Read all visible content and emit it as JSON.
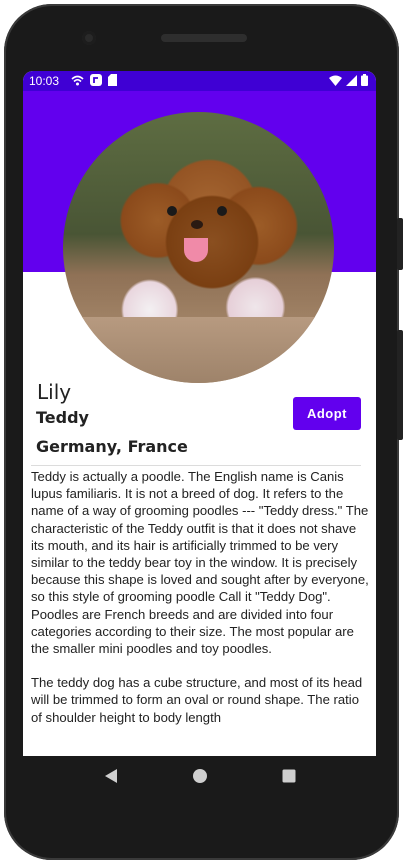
{
  "status": {
    "time": "10:03"
  },
  "pet": {
    "name": "Lily",
    "breed": "Teddy",
    "origin": "Germany, France"
  },
  "actions": {
    "adopt_label": "Adopt"
  },
  "description": {
    "paragraph1": "Teddy is actually a poodle. The English name is Canis lupus familiaris. It is not a breed of dog. It refers to the name of a way of grooming poodles --- \"Teddy dress.\" The characteristic of the Teddy outfit is that it does not shave its mouth, and its hair is artificially trimmed to be very similar to the teddy bear toy in the window. It is precisely because this shape is loved and sought after by everyone, so this style of grooming poodle Call it \"Teddy Dog\". Poodles are French breeds and are divided into four categories according to their size. The most popular are the smaller mini poodles and toy poodles.",
    "paragraph2": "The teddy dog has a cube structure, and most of its head will be trimmed to form an oval or round shape. The ratio of shoulder height to body length"
  },
  "colors": {
    "primary": "#6200ee",
    "status_bar": "#3f00d4"
  },
  "icons": {
    "status_left": [
      "wifi-calling-icon",
      "app-notification-icon",
      "sd-card-icon"
    ],
    "status_right": [
      "wifi-icon",
      "signal-icon",
      "battery-icon"
    ],
    "navigation": [
      "back-icon",
      "home-icon",
      "recents-icon"
    ]
  }
}
